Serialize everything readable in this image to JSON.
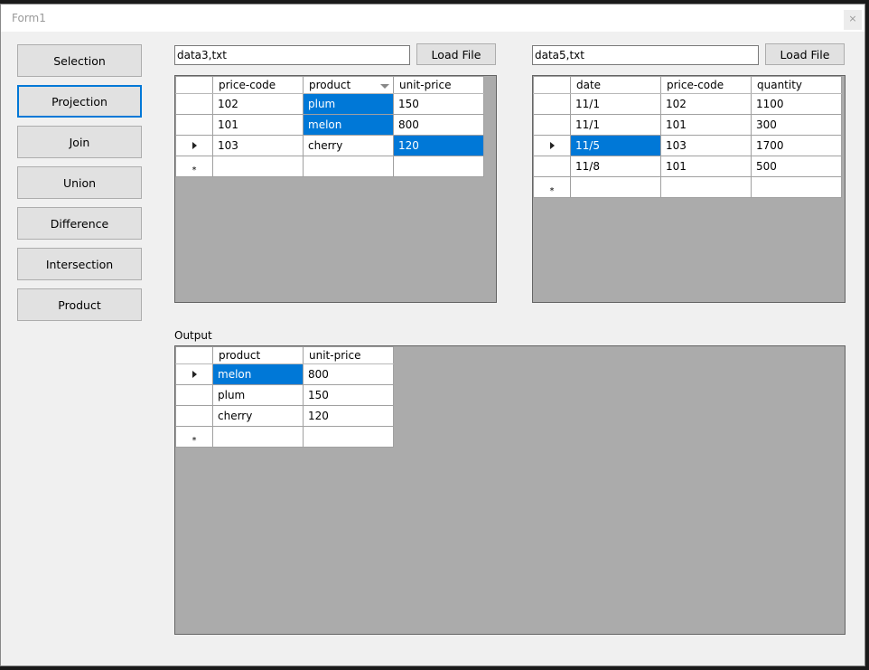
{
  "window": {
    "title": "Form1",
    "close_glyph": "×"
  },
  "operations": [
    {
      "label": "Selection"
    },
    {
      "label": "Projection"
    },
    {
      "label": "Join"
    },
    {
      "label": "Union"
    },
    {
      "label": "Difference"
    },
    {
      "label": "Intersection"
    },
    {
      "label": "Product"
    }
  ],
  "left_panel": {
    "file_value": "data3,txt",
    "load_label": "Load File",
    "columns": [
      "price-code",
      "product",
      "unit-price"
    ],
    "rows": [
      [
        "102",
        "plum",
        "150"
      ],
      [
        "101",
        "melon",
        "800"
      ],
      [
        "103",
        "cherry",
        "120"
      ]
    ]
  },
  "right_panel": {
    "file_value": "data5,txt",
    "load_label": "Load File",
    "columns": [
      "date",
      "price-code",
      "quantity"
    ],
    "rows": [
      [
        "11/1",
        "102",
        "1100"
      ],
      [
        "11/1",
        "101",
        "300"
      ],
      [
        "11/5",
        "103",
        "1700"
      ],
      [
        "11/8",
        "101",
        "500"
      ]
    ]
  },
  "output": {
    "label": "Output",
    "columns": [
      "product",
      "unit-price"
    ],
    "rows": [
      [
        "melon",
        "800"
      ],
      [
        "plum",
        "150"
      ],
      [
        "cherry",
        "120"
      ]
    ]
  },
  "new_row_glyph": "*"
}
